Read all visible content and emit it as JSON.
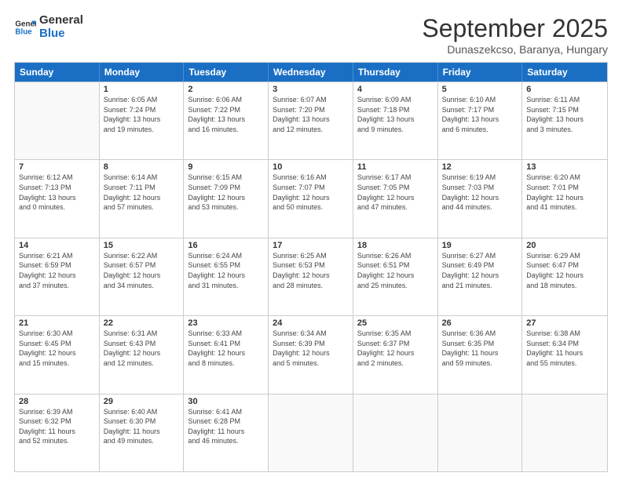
{
  "logo": {
    "line1": "General",
    "line2": "Blue"
  },
  "title": "September 2025",
  "location": "Dunaszekcso, Baranya, Hungary",
  "header_days": [
    "Sunday",
    "Monday",
    "Tuesday",
    "Wednesday",
    "Thursday",
    "Friday",
    "Saturday"
  ],
  "weeks": [
    [
      {
        "num": "",
        "info": ""
      },
      {
        "num": "1",
        "info": "Sunrise: 6:05 AM\nSunset: 7:24 PM\nDaylight: 13 hours\nand 19 minutes."
      },
      {
        "num": "2",
        "info": "Sunrise: 6:06 AM\nSunset: 7:22 PM\nDaylight: 13 hours\nand 16 minutes."
      },
      {
        "num": "3",
        "info": "Sunrise: 6:07 AM\nSunset: 7:20 PM\nDaylight: 13 hours\nand 12 minutes."
      },
      {
        "num": "4",
        "info": "Sunrise: 6:09 AM\nSunset: 7:18 PM\nDaylight: 13 hours\nand 9 minutes."
      },
      {
        "num": "5",
        "info": "Sunrise: 6:10 AM\nSunset: 7:17 PM\nDaylight: 13 hours\nand 6 minutes."
      },
      {
        "num": "6",
        "info": "Sunrise: 6:11 AM\nSunset: 7:15 PM\nDaylight: 13 hours\nand 3 minutes."
      }
    ],
    [
      {
        "num": "7",
        "info": "Sunrise: 6:12 AM\nSunset: 7:13 PM\nDaylight: 13 hours\nand 0 minutes."
      },
      {
        "num": "8",
        "info": "Sunrise: 6:14 AM\nSunset: 7:11 PM\nDaylight: 12 hours\nand 57 minutes."
      },
      {
        "num": "9",
        "info": "Sunrise: 6:15 AM\nSunset: 7:09 PM\nDaylight: 12 hours\nand 53 minutes."
      },
      {
        "num": "10",
        "info": "Sunrise: 6:16 AM\nSunset: 7:07 PM\nDaylight: 12 hours\nand 50 minutes."
      },
      {
        "num": "11",
        "info": "Sunrise: 6:17 AM\nSunset: 7:05 PM\nDaylight: 12 hours\nand 47 minutes."
      },
      {
        "num": "12",
        "info": "Sunrise: 6:19 AM\nSunset: 7:03 PM\nDaylight: 12 hours\nand 44 minutes."
      },
      {
        "num": "13",
        "info": "Sunrise: 6:20 AM\nSunset: 7:01 PM\nDaylight: 12 hours\nand 41 minutes."
      }
    ],
    [
      {
        "num": "14",
        "info": "Sunrise: 6:21 AM\nSunset: 6:59 PM\nDaylight: 12 hours\nand 37 minutes."
      },
      {
        "num": "15",
        "info": "Sunrise: 6:22 AM\nSunset: 6:57 PM\nDaylight: 12 hours\nand 34 minutes."
      },
      {
        "num": "16",
        "info": "Sunrise: 6:24 AM\nSunset: 6:55 PM\nDaylight: 12 hours\nand 31 minutes."
      },
      {
        "num": "17",
        "info": "Sunrise: 6:25 AM\nSunset: 6:53 PM\nDaylight: 12 hours\nand 28 minutes."
      },
      {
        "num": "18",
        "info": "Sunrise: 6:26 AM\nSunset: 6:51 PM\nDaylight: 12 hours\nand 25 minutes."
      },
      {
        "num": "19",
        "info": "Sunrise: 6:27 AM\nSunset: 6:49 PM\nDaylight: 12 hours\nand 21 minutes."
      },
      {
        "num": "20",
        "info": "Sunrise: 6:29 AM\nSunset: 6:47 PM\nDaylight: 12 hours\nand 18 minutes."
      }
    ],
    [
      {
        "num": "21",
        "info": "Sunrise: 6:30 AM\nSunset: 6:45 PM\nDaylight: 12 hours\nand 15 minutes."
      },
      {
        "num": "22",
        "info": "Sunrise: 6:31 AM\nSunset: 6:43 PM\nDaylight: 12 hours\nand 12 minutes."
      },
      {
        "num": "23",
        "info": "Sunrise: 6:33 AM\nSunset: 6:41 PM\nDaylight: 12 hours\nand 8 minutes."
      },
      {
        "num": "24",
        "info": "Sunrise: 6:34 AM\nSunset: 6:39 PM\nDaylight: 12 hours\nand 5 minutes."
      },
      {
        "num": "25",
        "info": "Sunrise: 6:35 AM\nSunset: 6:37 PM\nDaylight: 12 hours\nand 2 minutes."
      },
      {
        "num": "26",
        "info": "Sunrise: 6:36 AM\nSunset: 6:35 PM\nDaylight: 11 hours\nand 59 minutes."
      },
      {
        "num": "27",
        "info": "Sunrise: 6:38 AM\nSunset: 6:34 PM\nDaylight: 11 hours\nand 55 minutes."
      }
    ],
    [
      {
        "num": "28",
        "info": "Sunrise: 6:39 AM\nSunset: 6:32 PM\nDaylight: 11 hours\nand 52 minutes."
      },
      {
        "num": "29",
        "info": "Sunrise: 6:40 AM\nSunset: 6:30 PM\nDaylight: 11 hours\nand 49 minutes."
      },
      {
        "num": "30",
        "info": "Sunrise: 6:41 AM\nSunset: 6:28 PM\nDaylight: 11 hours\nand 46 minutes."
      },
      {
        "num": "",
        "info": ""
      },
      {
        "num": "",
        "info": ""
      },
      {
        "num": "",
        "info": ""
      },
      {
        "num": "",
        "info": ""
      }
    ]
  ]
}
